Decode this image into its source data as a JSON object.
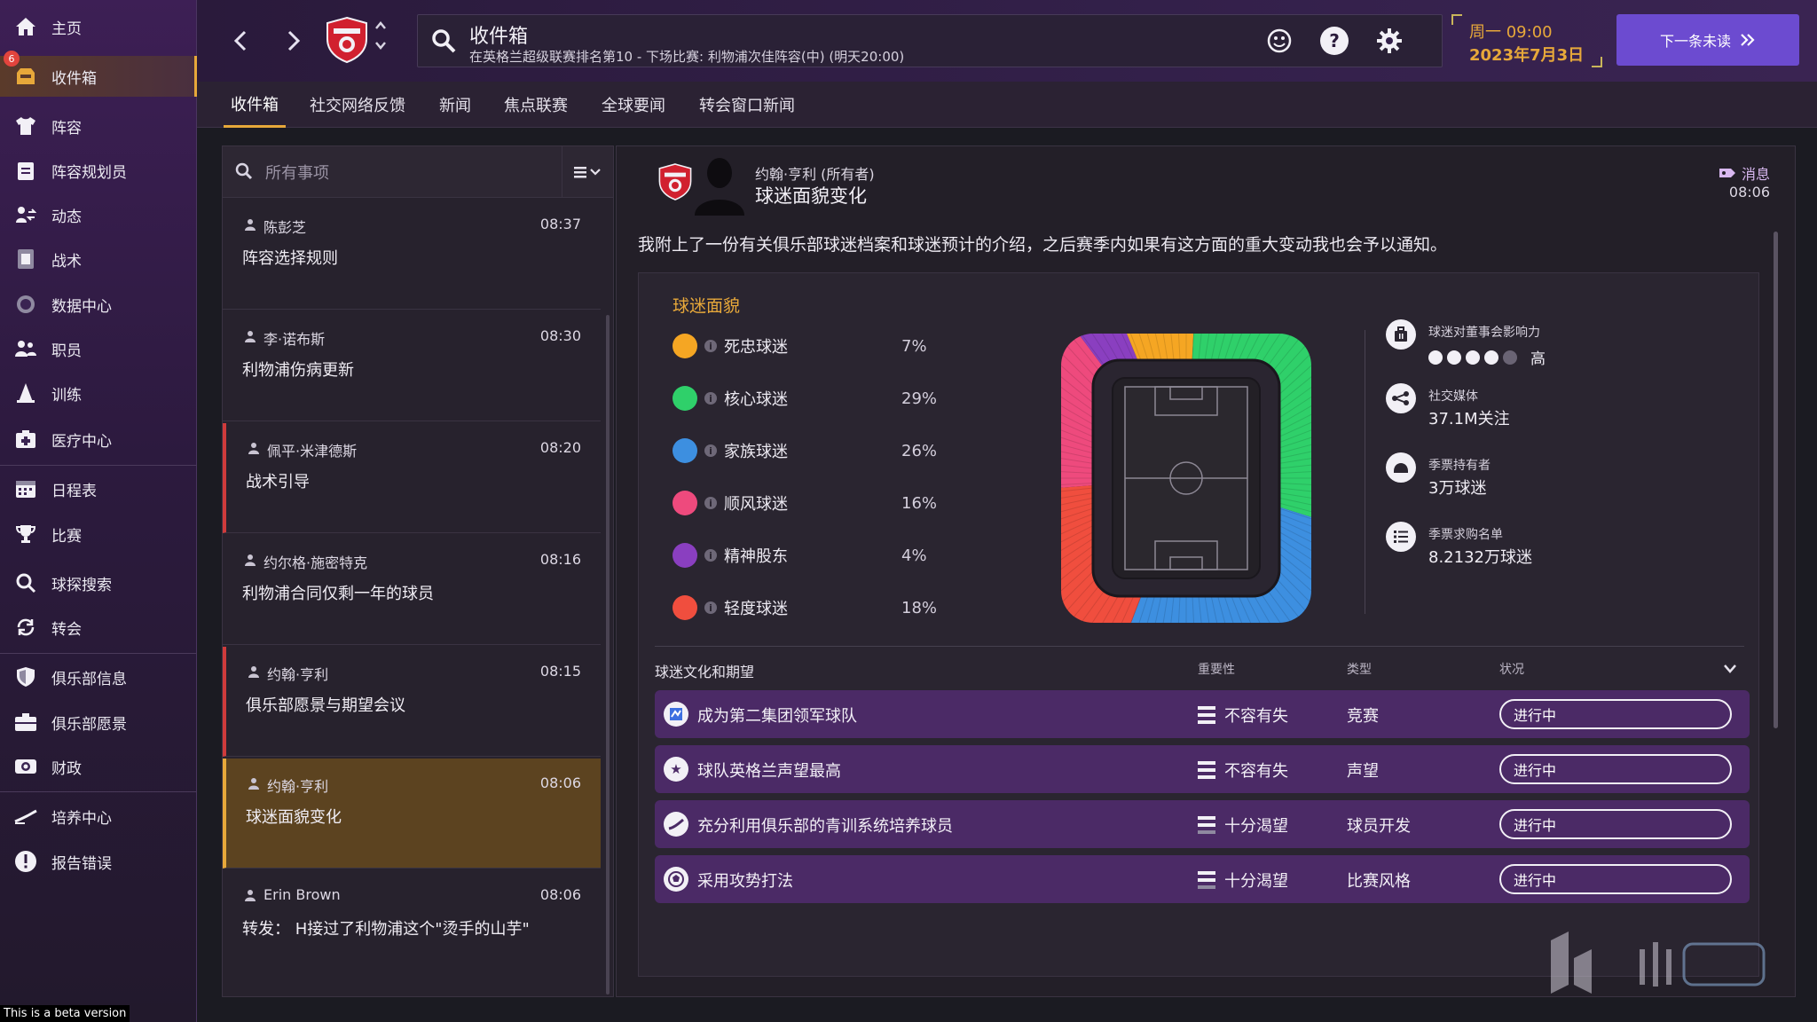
{
  "sidebar": {
    "badge": "6",
    "items": [
      {
        "label": "主页",
        "icon": "home-icon"
      },
      {
        "label": "收件箱",
        "icon": "inbox-icon"
      },
      {
        "label": "阵容",
        "icon": "shirt-icon"
      },
      {
        "label": "阵容规划员",
        "icon": "clipboard-icon"
      },
      {
        "label": "动态",
        "icon": "dynamics-icon"
      },
      {
        "label": "战术",
        "icon": "tactics-icon"
      },
      {
        "label": "数据中心",
        "icon": "data-icon"
      },
      {
        "label": "职员",
        "icon": "staff-icon"
      },
      {
        "label": "训练",
        "icon": "training-icon"
      },
      {
        "label": "医疗中心",
        "icon": "medical-icon"
      },
      {
        "label": "日程表",
        "icon": "calendar-icon"
      },
      {
        "label": "比赛",
        "icon": "trophy-icon"
      },
      {
        "label": "球探搜索",
        "icon": "scout-icon"
      },
      {
        "label": "转会",
        "icon": "transfer-icon"
      },
      {
        "label": "俱乐部信息",
        "icon": "shield-icon"
      },
      {
        "label": "俱乐部愿景",
        "icon": "vision-icon"
      },
      {
        "label": "财政",
        "icon": "finance-icon"
      },
      {
        "label": "培养中心",
        "icon": "development-icon"
      },
      {
        "label": "报告错误",
        "icon": "report-icon"
      }
    ],
    "beta_text": "This is a beta version"
  },
  "topbar": {
    "title": "收件箱",
    "subtitle": "在英格兰超级联赛排名第10 - 下场比赛: 利物浦次佳阵容(中) (明天20:00)",
    "date_line1": "周一 09:00",
    "date_line2": "2023年7月3日",
    "next_button": "下一条未读"
  },
  "tabs": [
    "收件箱",
    "社交网络反馈",
    "新闻",
    "焦点联赛",
    "全球要闻",
    "转会窗口新闻"
  ],
  "list": {
    "search_placeholder": "所有事项",
    "messages": [
      {
        "sender": "陈彭芝",
        "time": "08:37",
        "subject": "阵容选择规则"
      },
      {
        "sender": "李·诺布斯",
        "time": "08:30",
        "subject": "利物浦伤病更新"
      },
      {
        "sender": "佩平·米津德斯",
        "time": "08:20",
        "subject": "战术引导"
      },
      {
        "sender": "约尔格·施密特克",
        "time": "08:16",
        "subject": "利物浦合同仅剩一年的球员"
      },
      {
        "sender": "约翰·亨利",
        "time": "08:15",
        "subject": "俱乐部愿景与期望会议"
      },
      {
        "sender": "约翰·亨利",
        "time": "08:06",
        "subject": "球迷面貌变化"
      },
      {
        "sender": "Erin Brown",
        "time": "08:06",
        "subject": "转发： H接过了利物浦这个\"烫手的山芋\""
      }
    ]
  },
  "detail": {
    "sender": "约翰·亨利 (所有者)",
    "title": "球迷面貌变化",
    "tag": "消息",
    "time": "08:06",
    "body": "我附上了一份有关俱乐部球迷档案和球迷预计的介绍，之后赛季内如果有这方面的重大变动我也会予以通知。",
    "fan_heading": "球迷面貌",
    "segments": [
      {
        "name": "死忠球迷",
        "pct": "7%",
        "value": 7,
        "color": "#f5a623"
      },
      {
        "name": "核心球迷",
        "pct": "29%",
        "value": 29,
        "color": "#2fd06a"
      },
      {
        "name": "家族球迷",
        "pct": "26%",
        "value": 26,
        "color": "#3d8fe0"
      },
      {
        "name": "顺风球迷",
        "pct": "16%",
        "value": 16,
        "color": "#ee4a7d"
      },
      {
        "name": "精神股东",
        "pct": "4%",
        "value": 4,
        "color": "#8a3fc0"
      },
      {
        "name": "轻度球迷",
        "pct": "18%",
        "value": 18,
        "color": "#f04e3e"
      }
    ],
    "stats": {
      "board_influence_label": "球迷对董事会影响力",
      "board_influence_level": "高",
      "board_influence_dots": 4,
      "social_label": "社交媒体",
      "social_value": "37.1M关注",
      "season_label": "季票持有者",
      "season_value": "3万球迷",
      "waitlist_label": "季票求购名单",
      "waitlist_value": "8.2132万球迷"
    },
    "expectations": {
      "heading": "球迷文化和期望",
      "col_importance": "重要性",
      "col_type": "类型",
      "col_status": "状况",
      "rows": [
        {
          "name": "成为第二集团领军球队",
          "importance": "不容有失",
          "type": "竞赛",
          "status": "进行中",
          "icon": "league-icon"
        },
        {
          "name": "球队英格兰声望最高",
          "importance": "不容有失",
          "type": "声望",
          "status": "进行中",
          "icon": "star-icon"
        },
        {
          "name": "充分利用俱乐部的青训系统培养球员",
          "importance": "十分渴望",
          "type": "球员开发",
          "status": "进行中",
          "icon": "youth-icon"
        },
        {
          "name": "采用攻势打法",
          "importance": "十分渴望",
          "type": "比赛风格",
          "status": "进行中",
          "icon": "ball-icon"
        }
      ]
    }
  },
  "colors": {
    "accent": "#e7a83a",
    "next_button": "#6c4bd0",
    "row_purple": "#4b2a66"
  }
}
